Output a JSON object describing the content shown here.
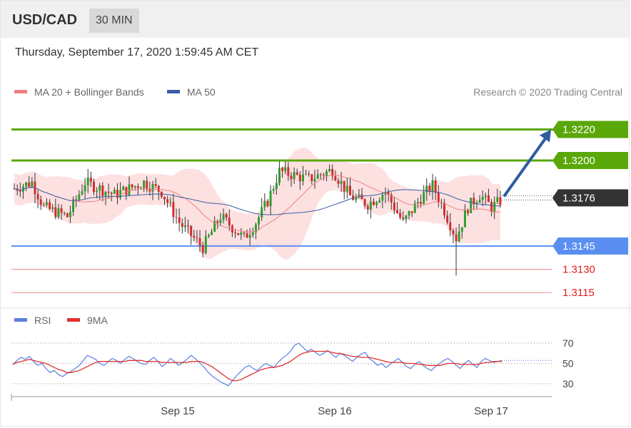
{
  "header": {
    "pair": "USD/CAD",
    "timeframe": "30 MIN"
  },
  "timestamp": "Thursday, September 17, 2020 1:59:45 AM CET",
  "colors": {
    "up": "#2e9e2e",
    "down": "#d62c2c",
    "resistance": "#5aa70a",
    "support": "#5a8ef0",
    "current": "#333333",
    "ma50": "#3a5ea3",
    "ma20": "#f08080",
    "band": "#fcd7d7",
    "rsi": "#5a7fe0",
    "rsi_ma": "#e03030"
  },
  "chart_data": [
    {
      "type": "candlestick",
      "legend": [
        {
          "label": "MA 20 + Bollinger Bands",
          "color": "#f08080"
        },
        {
          "label": "MA 50",
          "color": "#3a5ea3"
        }
      ],
      "credit": "Research © 2020 Trading Central",
      "ylim": [
        1.3105,
        1.3245
      ],
      "x_ticks": [
        "Sep 15",
        "Sep 16",
        "Sep 17"
      ],
      "levels": [
        {
          "label": "1.3220",
          "value": 1.322,
          "kind": "resistance",
          "style": "flag"
        },
        {
          "label": "1.3200",
          "value": 1.32,
          "kind": "resistance",
          "style": "flag"
        },
        {
          "label": "1.3176",
          "value": 1.3176,
          "kind": "current",
          "style": "flag"
        },
        {
          "label": "1.3145",
          "value": 1.3145,
          "kind": "support",
          "style": "flag"
        },
        {
          "label": "1.3130",
          "value": 1.313,
          "kind": "support",
          "style": "text"
        },
        {
          "label": "1.3115",
          "value": 1.3115,
          "kind": "support",
          "style": "text"
        }
      ],
      "projection": {
        "from": 1.3176,
        "to": 1.322,
        "direction": "up"
      },
      "candles": []
    },
    {
      "type": "line",
      "legend": [
        {
          "label": "RSI",
          "color": "#5a7fe0"
        },
        {
          "label": "9MA",
          "color": "#e03030"
        }
      ],
      "ylim": [
        20,
        80
      ],
      "y_ticks": [
        "70",
        "50",
        "30"
      ],
      "series": [
        {
          "name": "RSI",
          "values": [
            49,
            53,
            56,
            54,
            57,
            52,
            48,
            50,
            45,
            41,
            43,
            39,
            37,
            40,
            42,
            45,
            48,
            53,
            58,
            56,
            54,
            50,
            48,
            52,
            55,
            53,
            50,
            54,
            57,
            55,
            52,
            50,
            49,
            53,
            56,
            52,
            47,
            50,
            55,
            52,
            48,
            51,
            54,
            58,
            55,
            51,
            47,
            42,
            38,
            35,
            32,
            30,
            28,
            33,
            38,
            42,
            46,
            48,
            45,
            43,
            47,
            50,
            48,
            46,
            51,
            55,
            58,
            62,
            68,
            70,
            66,
            62,
            64,
            61,
            58,
            60,
            63,
            59,
            56,
            60,
            58,
            55,
            52,
            56,
            59,
            61,
            55,
            52,
            48,
            50,
            46,
            49,
            52,
            55,
            51,
            47,
            45,
            49,
            52,
            48,
            45,
            43,
            47,
            50,
            53,
            55,
            52,
            48,
            45,
            50,
            53,
            49,
            46,
            52,
            55,
            53,
            51,
            52,
            53
          ]
        },
        {
          "name": "9MA",
          "values": [
            49,
            51,
            52,
            53,
            54,
            53,
            52,
            51,
            50,
            48,
            46,
            44,
            43,
            41,
            41,
            42,
            43,
            45,
            47,
            49,
            51,
            52,
            52,
            52,
            52,
            52,
            52,
            52,
            53,
            53,
            53,
            53,
            52,
            52,
            52,
            52,
            51,
            51,
            51,
            51,
            51,
            51,
            51,
            52,
            52,
            52,
            51,
            49,
            47,
            44,
            41,
            38,
            35,
            33,
            33,
            34,
            36,
            38,
            40,
            42,
            44,
            45,
            46,
            46,
            47,
            48,
            50,
            52,
            55,
            58,
            60,
            61,
            62,
            62,
            62,
            62,
            62,
            61,
            60,
            60,
            59,
            58,
            57,
            57,
            56,
            56,
            56,
            55,
            54,
            53,
            52,
            51,
            51,
            51,
            51,
            50,
            50,
            50,
            49,
            49,
            48,
            48,
            48,
            48,
            49,
            50,
            50,
            50,
            49,
            49,
            49,
            49,
            49,
            50,
            51,
            51,
            52,
            52,
            52
          ]
        }
      ]
    }
  ]
}
